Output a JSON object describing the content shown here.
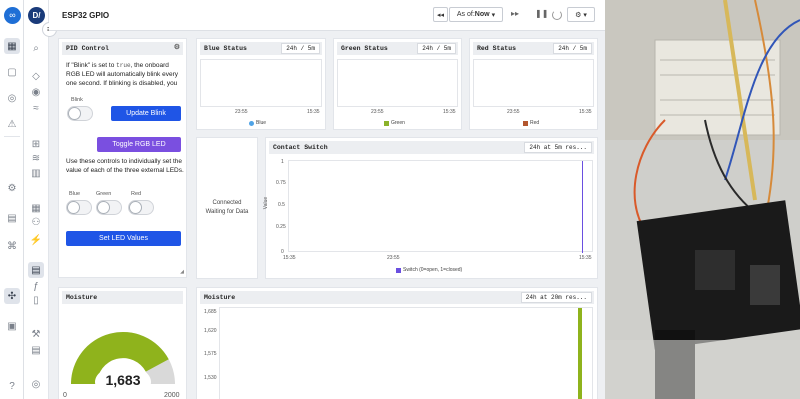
{
  "app": {
    "workspace_initials": "D/"
  },
  "dashboard": {
    "title": "ESP32 GPIO",
    "toolbar": {
      "back_label": "◂◂",
      "as_of_label": "As of: ",
      "as_of_value": "Now",
      "forward_label": "▸▸",
      "pause_label": "❚❚",
      "settings_label": "⚙ ▾"
    }
  },
  "panels": {
    "pid_control": {
      "title": "PID Control",
      "blink_text_1": "If \"Blink\" is set to ",
      "blink_code": "true",
      "blink_text_2": ", the onboard RGB LED will automatically blink every one second. If blinking is disabled, you",
      "blink_label": "Blink",
      "update_blink_button": "Update Blink",
      "toggle_rgb_button": "Toggle RGB LED",
      "individual_text": "Use these controls to individually set the value of each of the three external LEDs.",
      "blue_label": "Blue",
      "green_label": "Green",
      "red_label": "Red",
      "set_led_button": "Set LED Values"
    },
    "blue_status": {
      "title": "Blue Status",
      "range": "24h / 5m",
      "ticks": [
        "23:55",
        "15:35"
      ],
      "legend": "Blue",
      "color": "#4fa3e6"
    },
    "green_status": {
      "title": "Green Status",
      "range": "24h / 5m",
      "ticks": [
        "23:55",
        "15:35"
      ],
      "legend": "Green",
      "color": "#8bb22a"
    },
    "red_status": {
      "title": "Red Status",
      "range": "24h / 5m",
      "ticks": [
        "23:55",
        "15:35"
      ],
      "legend": "Red",
      "color": "#b3562e"
    },
    "connected": {
      "line1": "Connected",
      "line2": "Waiting for Data"
    },
    "contact_switch": {
      "title": "Contact Switch",
      "range": "24h at 5m res...",
      "ylabel": "Value",
      "yticks": [
        "1",
        "0.75",
        "0.5",
        "0.25",
        "0"
      ],
      "xticks": [
        "15:35",
        "23:55",
        "15:35"
      ],
      "legend": "Switch (0=open, 1=closed)",
      "color": "#6a4fe0"
    },
    "moisture_gauge": {
      "title": "Moisture",
      "value": "1,683",
      "min": "0",
      "max": "2000",
      "fraction": 0.8415,
      "color": "#8fb31c"
    },
    "moisture_chart": {
      "title": "Moisture",
      "range": "24h at 20m res...",
      "yticks": [
        "1,685",
        "1,620",
        "1,575",
        "1,530"
      ],
      "color": "#8fb31c"
    }
  }
}
